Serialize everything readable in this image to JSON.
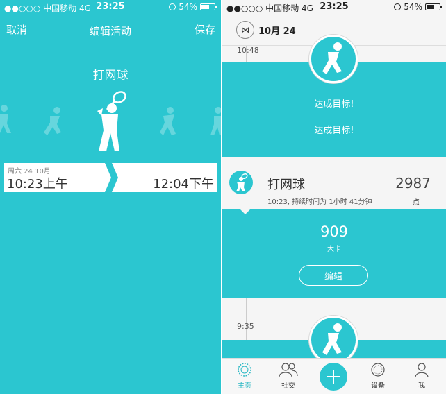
{
  "status_left": {
    "carrier": "●●○○○ 中国移动  4G",
    "time": "23:25",
    "battery": "54%",
    "battery_level": 0.54
  },
  "status_right": {
    "carrier": "●●○○○ 中国移动  4G",
    "time": "23:25",
    "battery": "54%",
    "battery_level": 0.54
  },
  "edit": {
    "cancel_label": "取消",
    "title": "编辑活动",
    "save_label": "保存",
    "activity": "打网球",
    "start_date": "周六 24 10月",
    "start_time": "10:23上午",
    "end_time": "12:04下午"
  },
  "feed": {
    "date_badge_icon": "bowtie-icon",
    "date_label": "10月 24",
    "timeline_time_top": "10:48",
    "goal_text_1": "达成目标!",
    "goal_text_2": "达成目标!",
    "card": {
      "title": "打网球",
      "subtitle": "10:23, 持续时间为 1小时 41分钟",
      "points": "2987",
      "points_label": "点"
    },
    "calories": "909",
    "calories_unit": "大卡",
    "edit_label": "编辑",
    "timeline_time_bottom": "9:35"
  },
  "tabs": [
    {
      "label": "主页",
      "icon": "home-icon",
      "active": true
    },
    {
      "label": "社交",
      "icon": "social-icon",
      "active": false
    },
    {
      "label": "",
      "icon": "plus-icon",
      "active": false
    },
    {
      "label": "设备",
      "icon": "device-icon",
      "active": false
    },
    {
      "label": "我",
      "icon": "profile-icon",
      "active": false
    }
  ],
  "colors": {
    "accent": "#2bc6d0",
    "card_bg": "#f5f5f5",
    "text_dark": "#333333"
  }
}
